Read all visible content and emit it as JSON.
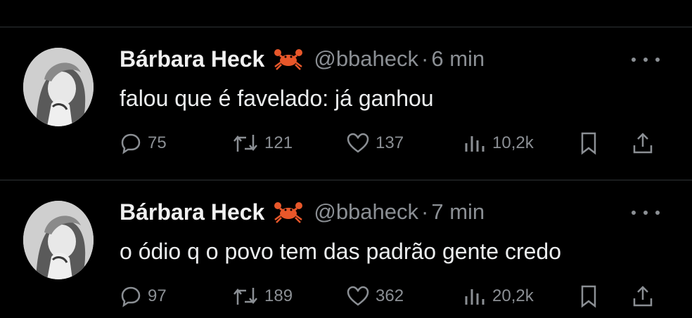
{
  "tweets": [
    {
      "display_name": "Bárbara Heck",
      "emoji": "crab-icon",
      "handle": "@bbaheck",
      "separator": "·",
      "time": "6 min",
      "text": "falou que é favelado: já ganhou",
      "replies": "75",
      "retweets": "121",
      "likes": "137",
      "views": "10,2k"
    },
    {
      "display_name": "Bárbara Heck",
      "emoji": "crab-icon",
      "handle": "@bbaheck",
      "separator": "·",
      "time": "7 min",
      "text": "o ódio q o povo tem das padrão gente credo",
      "replies": "97",
      "retweets": "189",
      "likes": "362",
      "views": "20,2k"
    }
  ],
  "colors": {
    "background": "#000000",
    "text": "#e7e9ea",
    "muted": "#8b8f94",
    "divider": "#2f3336",
    "crab": "#e8572a"
  }
}
